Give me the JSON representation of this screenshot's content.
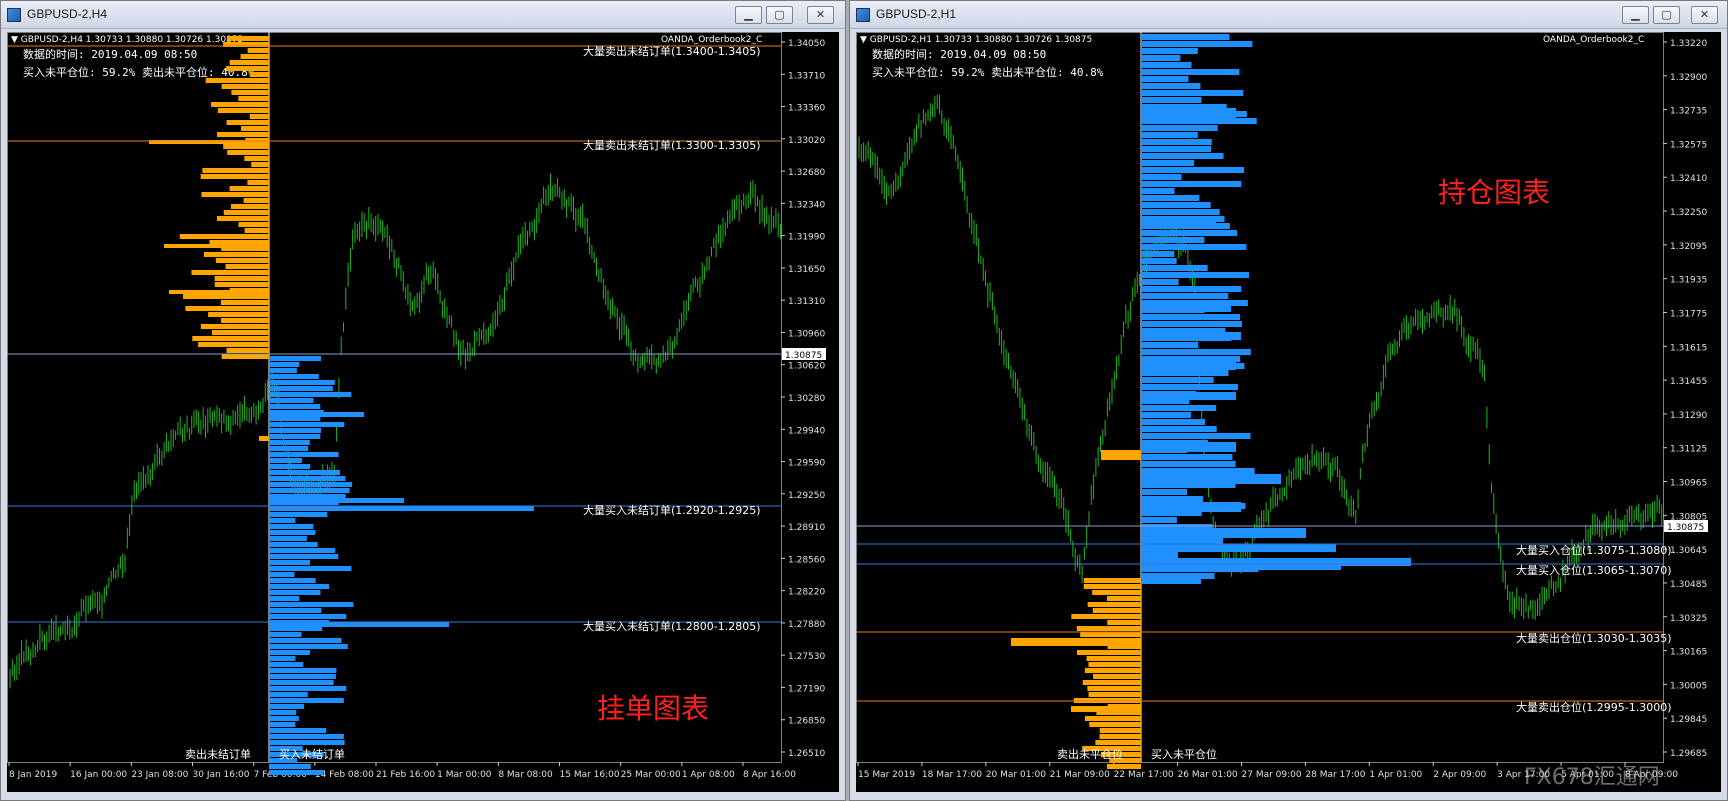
{
  "left_window": {
    "title": "GBPUSD-2,H4",
    "chart_header": "GBPUSD-2,H4  1.30733 1.30880 1.30726 1.30875",
    "indicator_name": "OANDA_Orderbook2_C",
    "info_time": "数据的时间: 2019.04.09 08:50",
    "info_ratio": "买入未平仓位: 59.2%  卖出未平仓位: 40.8%",
    "watermark": "挂单图表",
    "bottom_label_sell": "卖出未结订单",
    "bottom_label_buy": "买入未结订单",
    "current_price": "1.30875",
    "price_scale": [
      "1.34050",
      "1.33710",
      "1.33360",
      "1.33020",
      "1.32680",
      "1.32340",
      "1.31990",
      "1.31650",
      "1.31310",
      "1.30960",
      "1.30620",
      "1.30280",
      "1.29940",
      "1.29590",
      "1.29250",
      "1.28910",
      "1.28560",
      "1.28220",
      "1.27880",
      "1.27530",
      "1.27190",
      "1.26850",
      "1.26510"
    ],
    "time_axis": [
      "8 Jan 2019",
      "16 Jan 00:00",
      "23 Jan 08:00",
      "30 Jan 16:00",
      "7 Feb 00:00",
      "14 Feb 08:00",
      "21 Feb 16:00",
      "1 Mar 00:00",
      "8 Mar 08:00",
      "15 Mar 16:00",
      "25 Mar 00:00",
      "1 Apr 08:00",
      "8 Apr 16:00"
    ],
    "level_labels": [
      "大量卖出未结订单(1.3400-1.3405)",
      "大量卖出未结订单(1.3300-1.3305)",
      "大量买入未结订单(1.2920-1.2925)",
      "大量买入未结订单(1.2800-1.2805)"
    ]
  },
  "right_window": {
    "title": "GBPUSD-2,H1",
    "chart_header": "GBPUSD-2,H1  1.30733 1.30880 1.30726 1.30875",
    "indicator_name": "OANDA_Orderbook2_C",
    "info_time": "数据的时间: 2019.04.09 08:50",
    "info_ratio": "买入未平仓位: 59.2%  卖出未平仓位: 40.8%",
    "watermark": "持仓图表",
    "bottom_label_sell": "卖出未平仓位",
    "bottom_label_buy": "买入未平仓位",
    "current_price": "1.30875",
    "price_scale": [
      "1.33220",
      "1.32900",
      "1.32735",
      "1.32575",
      "1.32410",
      "1.32250",
      "1.32095",
      "1.31935",
      "1.31775",
      "1.31615",
      "1.31455",
      "1.31290",
      "1.31125",
      "1.30965",
      "1.30805",
      "1.30645",
      "1.30485",
      "1.30325",
      "1.30165",
      "1.30005",
      "1.29845",
      "1.29685"
    ],
    "time_axis": [
      "15 Mar 2019",
      "18 Mar 17:00",
      "20 Mar 01:00",
      "21 Mar 09:00",
      "22 Mar 17:00",
      "26 Mar 01:00",
      "27 Mar 09:00",
      "28 Mar 17:00",
      "1 Apr 01:00",
      "2 Apr 09:00",
      "3 Apr 17:00",
      "5 Apr 01:00",
      "8 Apr 09:00"
    ],
    "level_labels": [
      "大量买入仓位(1.3075-1.3080)",
      "大量买入仓位(1.3065-1.3070)",
      "大量卖出仓位(1.3030-1.3035)",
      "大量卖出仓位(1.2995-1.3000)"
    ],
    "brand": "FX678汇通网"
  },
  "window_buttons": {
    "minimize": "▁",
    "maximize": "▢",
    "close": "✕"
  },
  "colors": {
    "candle": "#22b422",
    "sell": "#ffa500",
    "buy": "#1e90ff",
    "level_line_buy": "#3a7bd5",
    "level_line_sell": "#e08020",
    "watermark": "#ff2020"
  }
}
